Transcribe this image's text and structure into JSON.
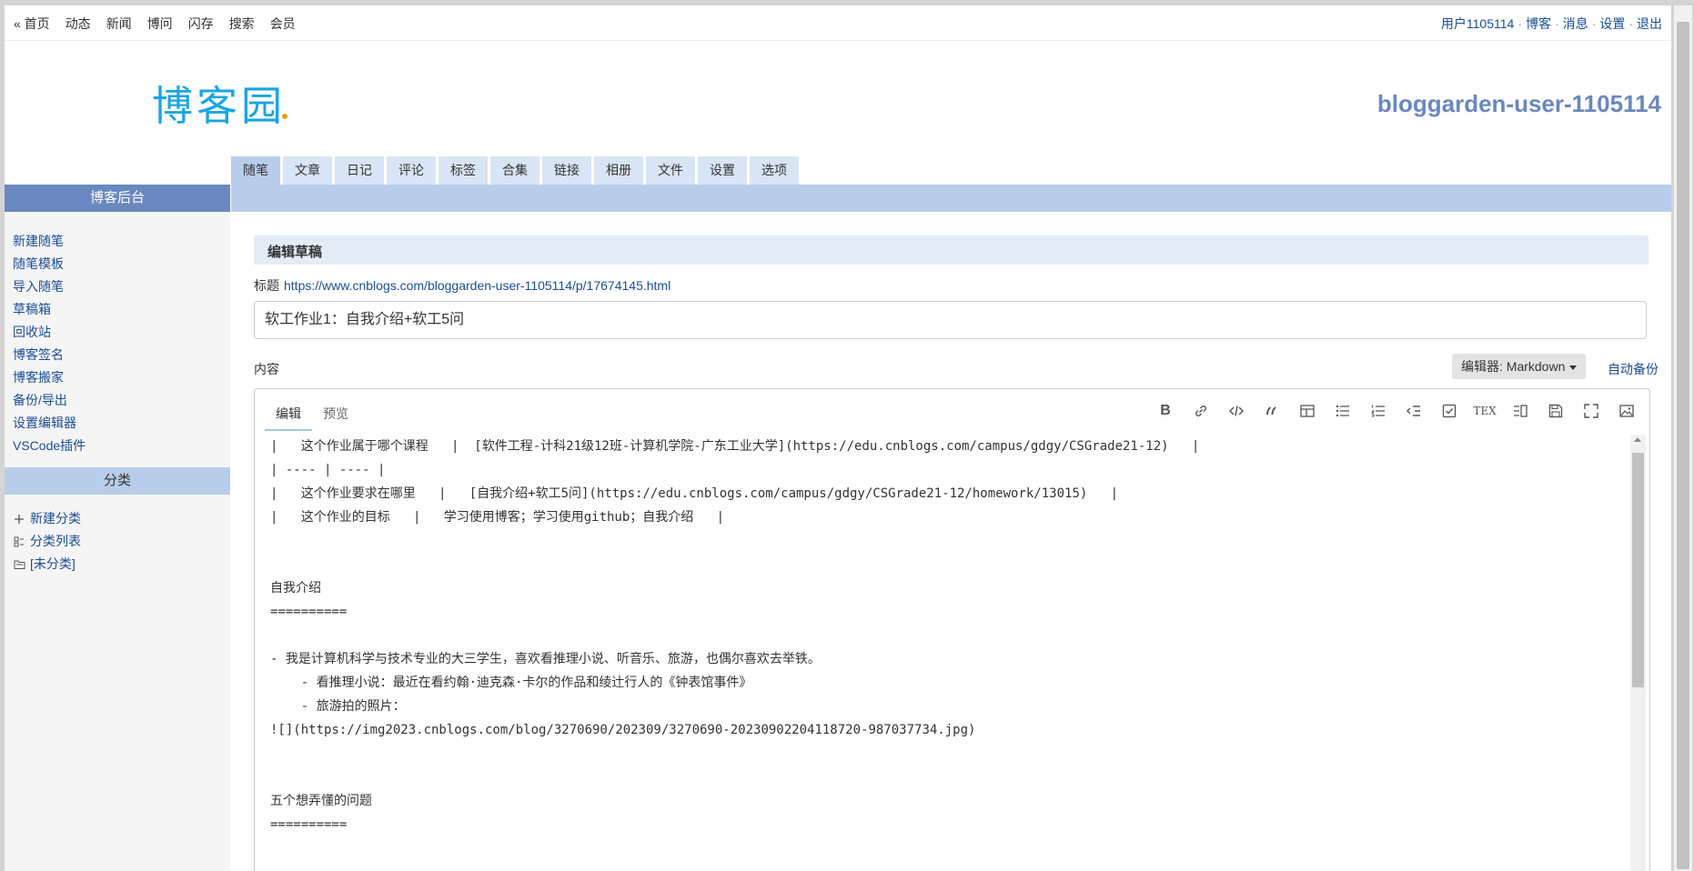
{
  "topnav": {
    "left": [
      "« 首页",
      "动态",
      "新闻",
      "博问",
      "闪存",
      "搜索",
      "会员"
    ],
    "user": "用户1105114",
    "blog": "博客",
    "messages": "消息",
    "settings": "设置",
    "logout": "退出",
    "sep": "·"
  },
  "header": {
    "logo_text": "博客园",
    "blog_title": "bloggarden-user-1105114"
  },
  "tabs": [
    "随笔",
    "文章",
    "日记",
    "评论",
    "标签",
    "合集",
    "链接",
    "相册",
    "文件",
    "设置",
    "选项"
  ],
  "sidebar": {
    "heading": "博客后台",
    "items": [
      "新建随笔",
      "随笔模板",
      "导入随笔",
      "草稿箱",
      "回收站",
      "博客签名",
      "博客搬家",
      "备份/导出",
      "设置编辑器",
      "VSCode插件"
    ],
    "category_heading": "分类",
    "categories": [
      {
        "label": "新建分类",
        "icon": "plus-icon"
      },
      {
        "label": "分类列表",
        "icon": "list-icon"
      },
      {
        "label": "[未分类]",
        "icon": "folder-icon"
      }
    ]
  },
  "main": {
    "section_title": "编辑草稿",
    "title_label": "标题",
    "title_url": "https://www.cnblogs.com/bloggarden-user-1105114/p/17674145.html",
    "title_value": "软工作业1：自我介绍+软工5问",
    "content_label": "内容",
    "editor_select": "编辑器: Markdown",
    "autobackup": "自动备份",
    "editor_tabs": [
      "编辑",
      "预览"
    ],
    "content_lines": [
      "|   这个作业属于哪个课程   |  [软件工程-计科21级12班-计算机学院-广东工业大学](https://edu.cnblogs.com/campus/gdgy/CSGrade21-12)   |",
      "| ---- | ---- |",
      "|   这个作业要求在哪里   |   [自我介绍+软工5问](https://edu.cnblogs.com/campus/gdgy/CSGrade21-12/homework/13015)   |",
      "|   这个作业的目标   |   学习使用博客；学习使用github；自我介绍   |",
      "",
      "",
      "自我介绍",
      "==========",
      "",
      "- 我是计算机科学与技术专业的大三学生，喜欢看推理小说、听音乐、旅游，也偶尔喜欢去举铁。",
      "    - 看推理小说：最近在看约翰·迪克森·卡尔的作品和绫辻行人的《钟表馆事件》",
      "    - 旅游拍的照片：",
      "![](https://img2023.cnblogs.com/blog/3270690/202309/3270690-20230902204118720-987037734.jpg)",
      "",
      "",
      "五个想弄懂的问题",
      "=========="
    ]
  },
  "toolbar_icons": [
    "bold-icon",
    "link-icon",
    "code-icon",
    "quote-icon",
    "table-icon",
    "unordered-list-icon",
    "ordered-list-icon",
    "outdent-icon",
    "checkbox-icon",
    "tex-icon",
    "split-view-icon",
    "save-icon",
    "fullscreen-icon",
    "image-icon"
  ],
  "toolbar_tex": "TEX",
  "toolbar_bold": "B"
}
